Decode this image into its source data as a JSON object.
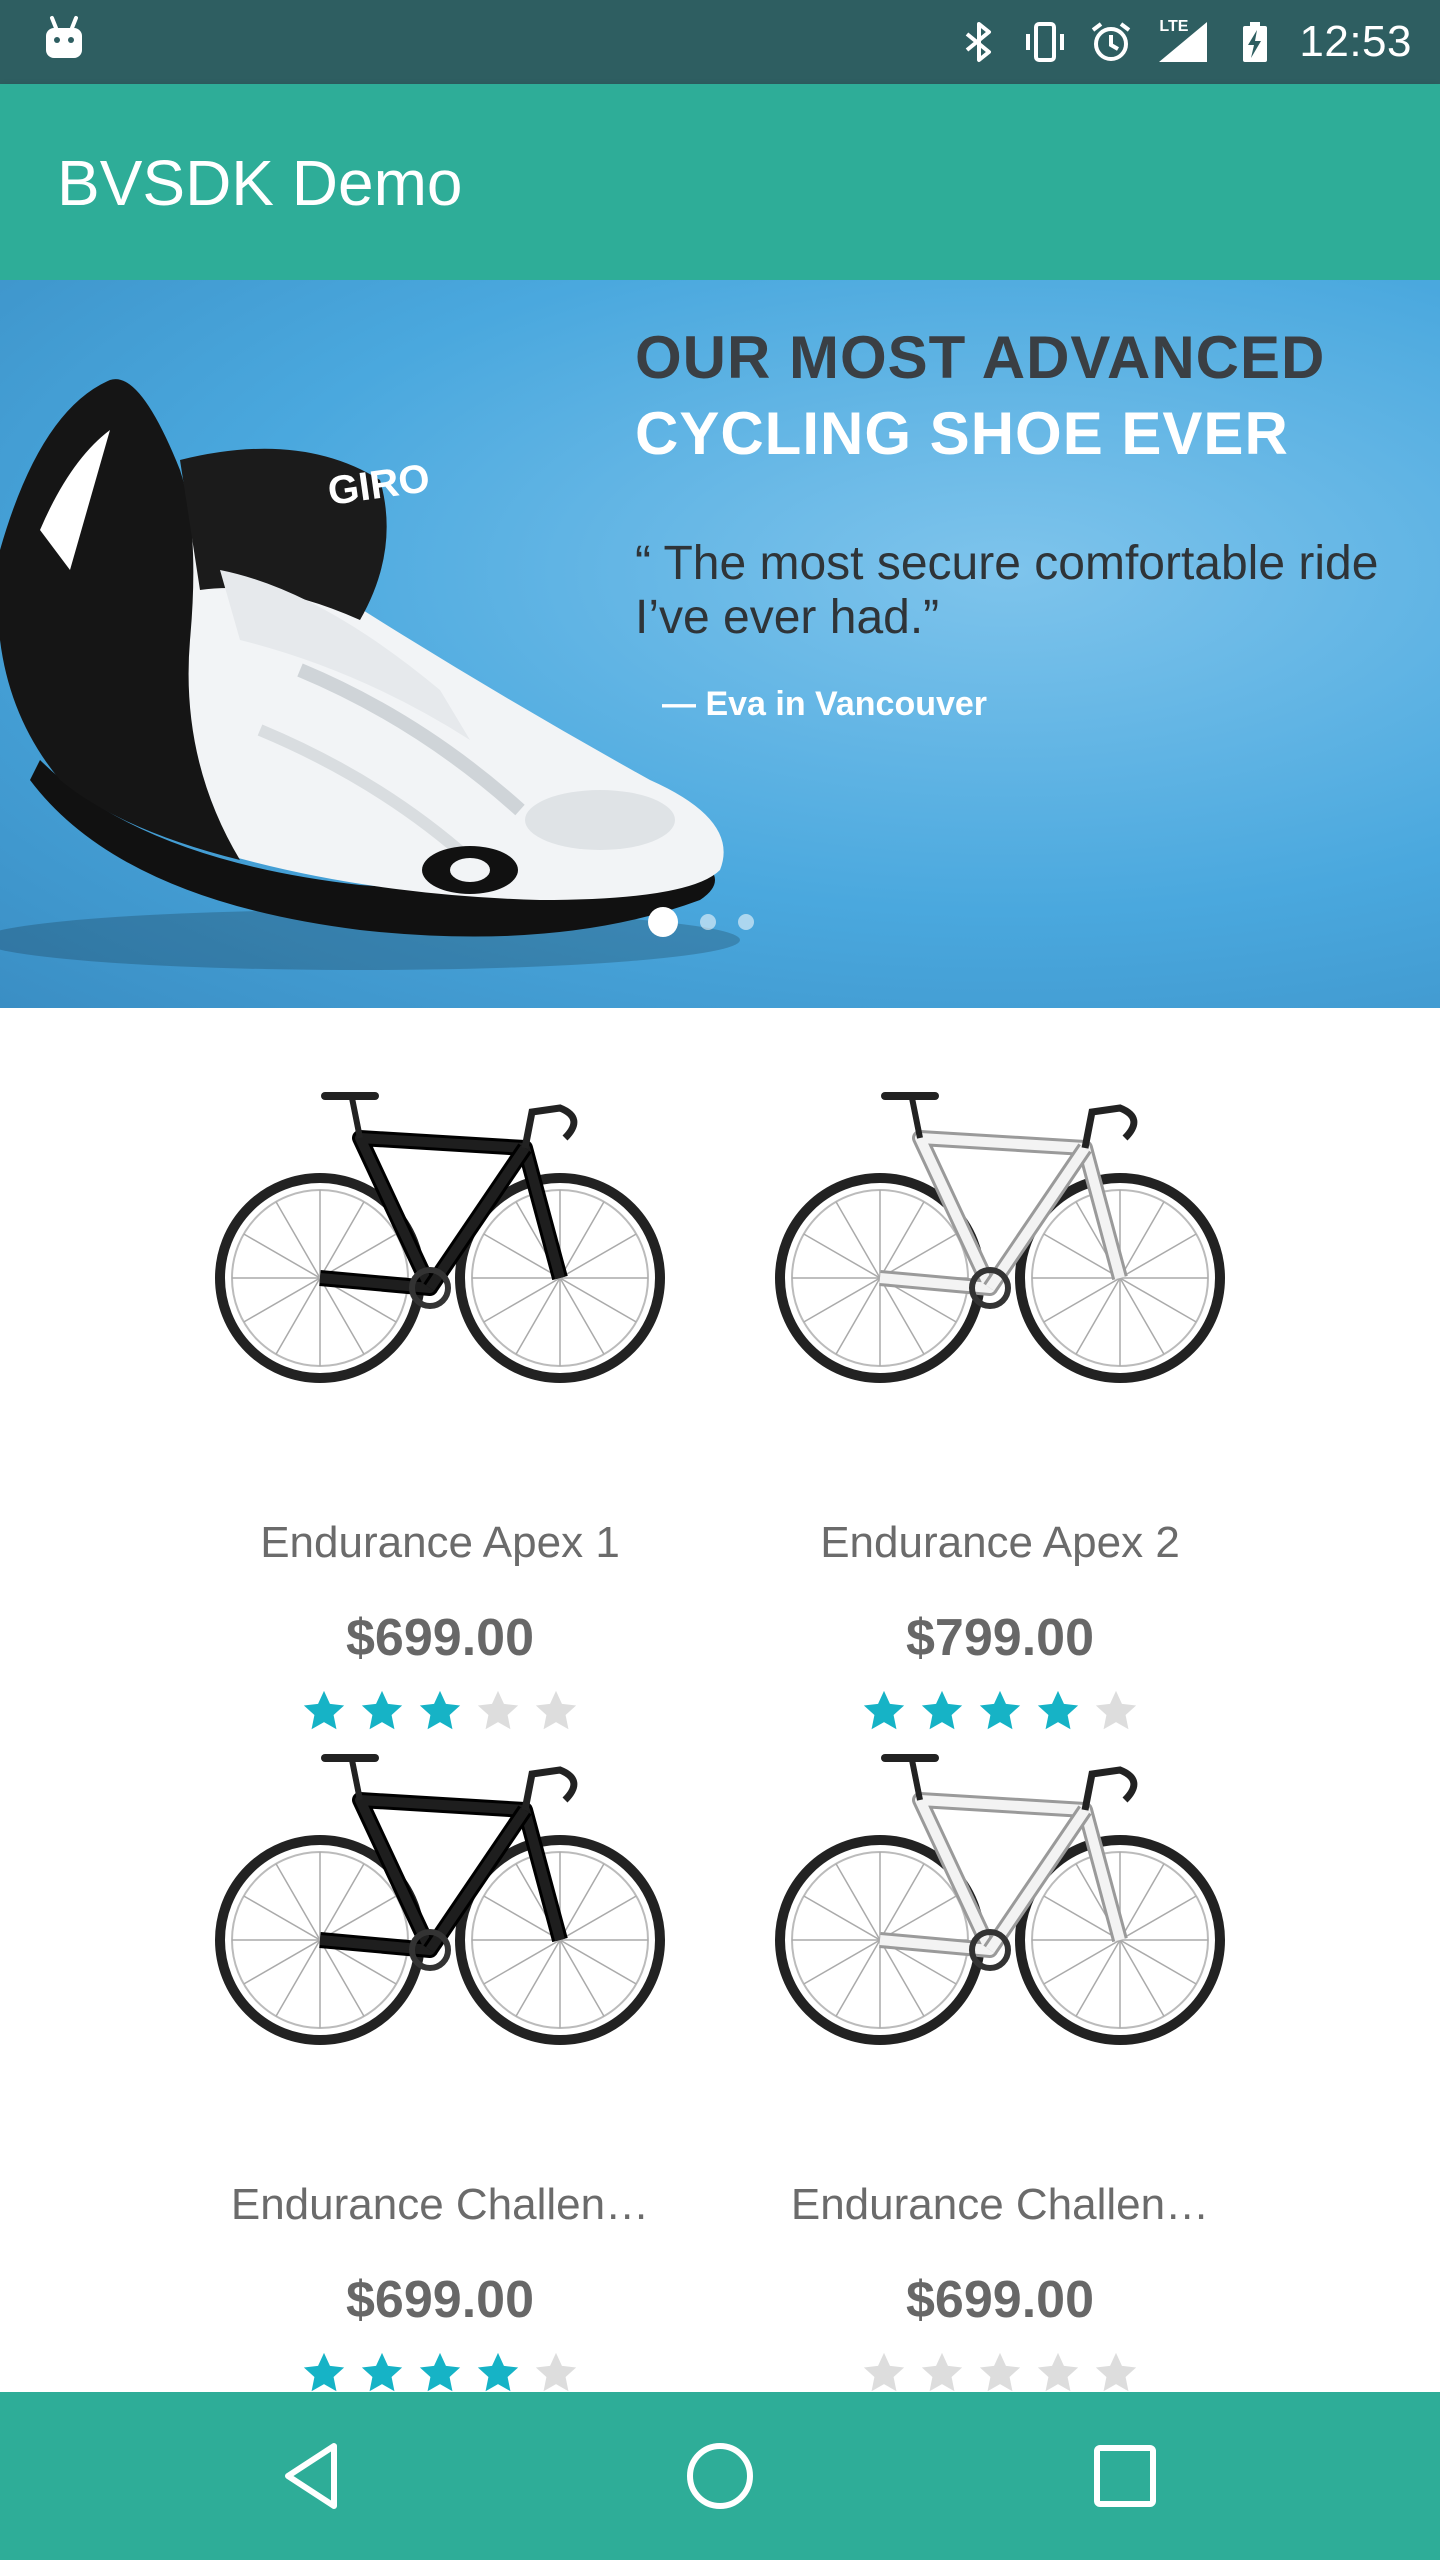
{
  "status_bar": {
    "time": "12:53",
    "network_label": "LTE",
    "icons": [
      "android-icon",
      "bluetooth-icon",
      "vibrate-icon",
      "alarm-icon",
      "signal-icon",
      "battery-charging-icon"
    ]
  },
  "app_bar": {
    "title": "BVSDK Demo"
  },
  "banner": {
    "headline_line1": "OUR MOST ADVANCED",
    "headline_line2": "CYCLING SHOE EVER",
    "quote": "“ The most secure comfortable ride I’ve ever had.”",
    "author": "— Eva in Vancouver",
    "logo_text": "GIRO",
    "slides_total": 3,
    "active_slide": 1,
    "colors": {
      "sky": "#4aa8de",
      "headline_dark": "#3a3f44"
    }
  },
  "products": [
    {
      "name": "Endurance Apex 1",
      "price": "$699.00",
      "rating": 3,
      "bike_color": "black"
    },
    {
      "name": "Endurance Apex 2",
      "price": "$799.00",
      "rating": 4,
      "bike_color": "white"
    },
    {
      "name": "Endurance Challen…",
      "price": "$699.00",
      "rating": 4,
      "bike_color": "black"
    },
    {
      "name": "Endurance Challen…",
      "price": "$699.00",
      "rating": 0,
      "bike_color": "white"
    }
  ],
  "rating_max": 5,
  "colors": {
    "status_bar": "#2e5e61",
    "accent": "#2ead98",
    "star_filled": "#16b3c6",
    "star_empty": "#dddddd",
    "text_gray": "#6b6b6b"
  },
  "nav_bar": {
    "buttons": [
      "back-icon",
      "home-icon",
      "recents-icon"
    ]
  }
}
